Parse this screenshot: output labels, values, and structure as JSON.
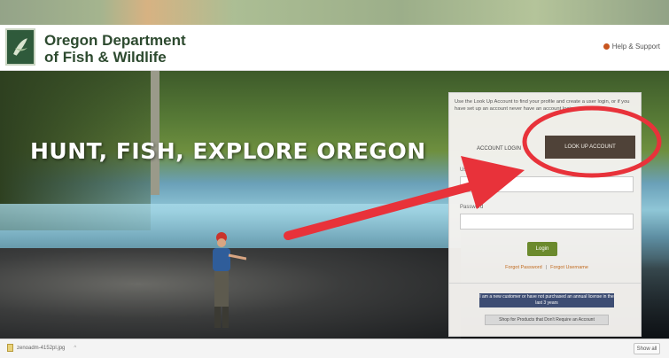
{
  "header": {
    "agency_line1": "Oregon Department",
    "agency_line2": "of Fish & Wildlife",
    "help_label": "Help & Support"
  },
  "hero": {
    "headline": "HUNT, FISH, EXPLORE OREGON"
  },
  "login_panel": {
    "intro_text": "Use the Look Up Account to find your profile and create a user login, or if you have set up an account never have an account login...",
    "tabs": {
      "account_login": "ACCOUNT LOGIN",
      "lookup_account": "LOOK UP ACCOUNT"
    },
    "username_label": "Username",
    "password_label": "Password",
    "login_button": "Login",
    "forgot_password": "Forgot Password",
    "forgot_username": "Forgot Username",
    "license_button": "I am a new customer or have not purchased an annual license in the last 3 years",
    "shop_button": "Shop for Products that Don't Require an Account"
  },
  "download_bar": {
    "file_name": "zenoadm-4152pl.jpg",
    "show_all": "Show all"
  },
  "colors": {
    "annotation": "#e8323a",
    "lookup_tab": "#4f4238",
    "login_button": "#6b8a2d",
    "license_button": "#3d4d73",
    "agency_text": "#2d4a2f"
  }
}
